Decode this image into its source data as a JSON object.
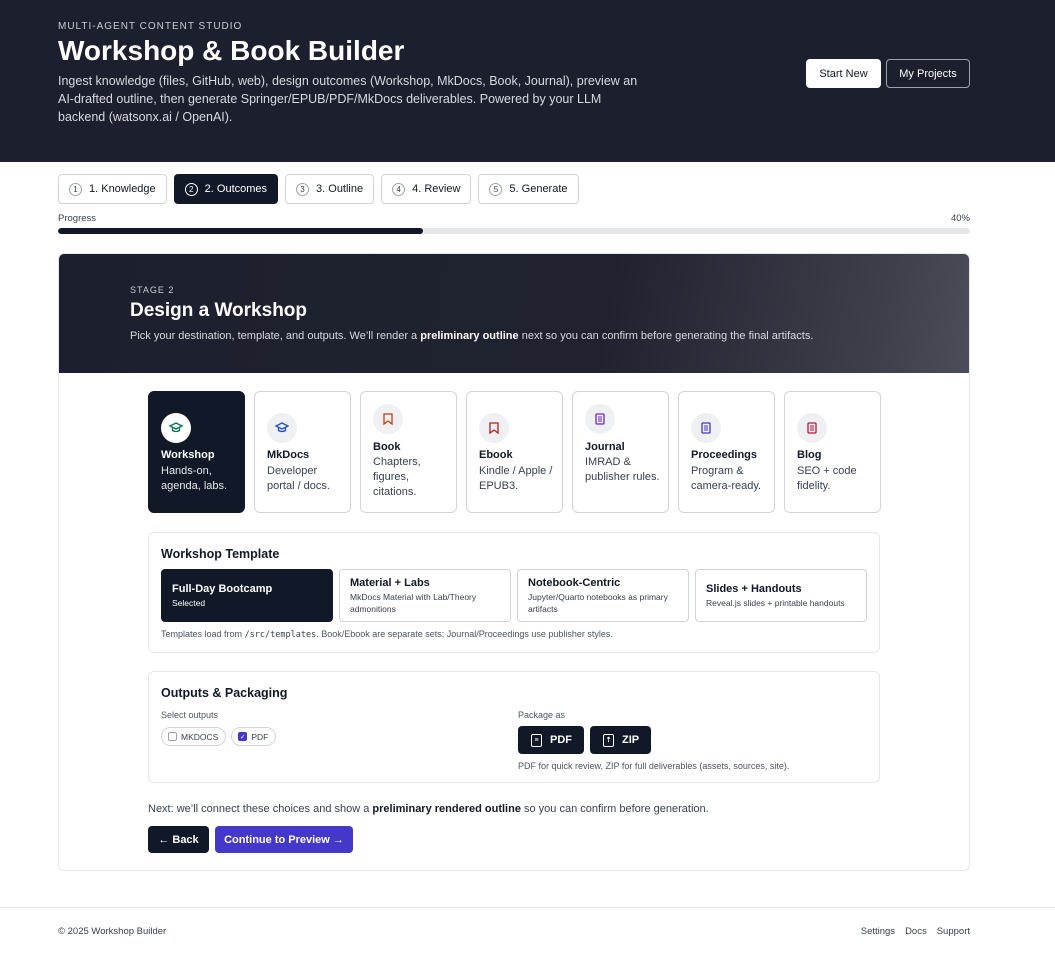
{
  "header": {
    "eyebrow": "MULTI-AGENT CONTENT STUDIO",
    "title": "Workshop & Book Builder",
    "description": "Ingest knowledge (files, GitHub, web), design outcomes (Workshop, MkDocs, Book, Journal), preview an AI-drafted outline, then generate Springer/EPUB/PDF/MkDocs deliverables. Powered by your LLM backend (watsonx.ai / OpenAI).",
    "start_new": "Start New",
    "my_projects": "My Projects"
  },
  "steps": [
    {
      "num": "1",
      "label": "1. Knowledge"
    },
    {
      "num": "2",
      "label": "2. Outcomes",
      "active": true
    },
    {
      "num": "3",
      "label": "3. Outline"
    },
    {
      "num": "4",
      "label": "4. Review"
    },
    {
      "num": "5",
      "label": "5. Generate"
    }
  ],
  "progress": {
    "label": "Progress",
    "percent_text": "40%",
    "value": 0.4
  },
  "stage": {
    "kicker": "STAGE 2",
    "title": "Design a Workshop",
    "sub_pre": "Pick your destination, template, and outputs. We’ll render a ",
    "sub_bold": "preliminary outline",
    "sub_post": " next so you can confirm before generating the final artifacts."
  },
  "outcomes": [
    {
      "title": "Workshop",
      "desc": "Hands-on, agenda, labs.",
      "icon": "graduation-cap-icon",
      "glyph": "🎓",
      "color": "#047857",
      "active": true
    },
    {
      "title": "MkDocs",
      "desc": "Developer portal / docs.",
      "icon": "graduation-cap-icon",
      "glyph": "🎓",
      "color": "#1d4ed8"
    },
    {
      "title": "Book",
      "desc": "Chapters, figures, citations.",
      "icon": "bookmark-icon",
      "glyph": "🔖",
      "color": "#c2410c"
    },
    {
      "title": "Ebook",
      "desc": "Kindle / Apple / EPUB3.",
      "icon": "bookmark-icon",
      "glyph": "🔖",
      "color": "#b91c1c"
    },
    {
      "title": "Journal",
      "desc": "IMRAD & publisher rules.",
      "icon": "document-icon",
      "glyph": "▤",
      "color": "#7e22ce"
    },
    {
      "title": "Proceedings",
      "desc": "Program & camera-ready.",
      "icon": "document-icon",
      "glyph": "▤",
      "color": "#4338ca"
    },
    {
      "title": "Blog",
      "desc": "SEO + code fidelity.",
      "icon": "document-icon",
      "glyph": "▤",
      "color": "#be123c"
    }
  ],
  "template": {
    "heading": "Workshop Template",
    "options": [
      {
        "title": "Full-Day Bootcamp",
        "desc": "Selected",
        "active": true
      },
      {
        "title": "Material + Labs",
        "desc": "MkDocs Material with Lab/Theory admonitions"
      },
      {
        "title": "Notebook-Centric",
        "desc": "Jupyter/Quarto notebooks as primary artifacts"
      },
      {
        "title": "Slides + Handouts",
        "desc": "Reveal.js slides + printable handouts"
      }
    ],
    "note_pre": "Templates load from ",
    "note_code": "/src/templates",
    "note_post": ". Book/Ebook are separate sets; Journal/Proceedings use publisher styles."
  },
  "outputs": {
    "heading": "Outputs & Packaging",
    "select_label": "Select outputs",
    "chips": [
      {
        "label": "MKDOCS",
        "checked": false
      },
      {
        "label": "PDF",
        "checked": true
      }
    ],
    "package_label": "Package as",
    "packages": [
      {
        "label": "PDF",
        "icon": "file-pdf-icon"
      },
      {
        "label": "ZIP",
        "icon": "file-zip-icon"
      }
    ],
    "package_note": "PDF for quick review, ZIP for full deliverables (assets, sources, site)."
  },
  "next_note": {
    "pre": "Next: we’ll connect these choices and show a ",
    "bold": "preliminary rendered outline",
    "post": " so you can confirm before generation."
  },
  "actions": {
    "back": "← Back",
    "continue": "Continue to Preview →"
  },
  "footer": {
    "copyright": "© 2025 Workshop Builder",
    "links": [
      "Settings",
      "Docs",
      "Support"
    ]
  }
}
